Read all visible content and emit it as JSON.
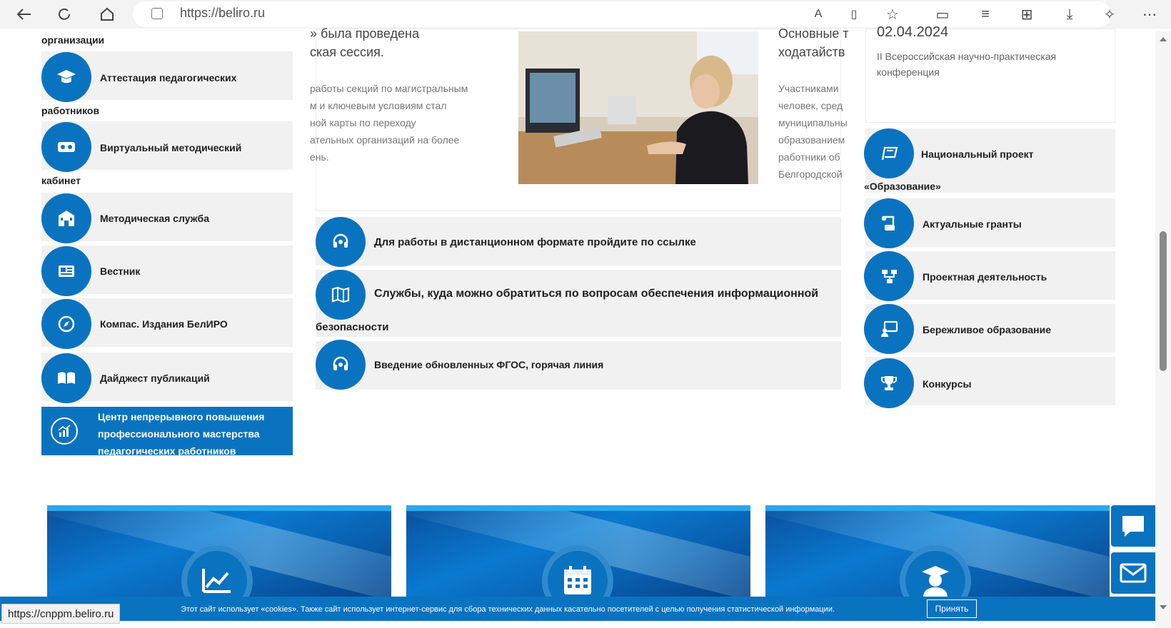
{
  "browser": {
    "url": "https://beliro.ru",
    "status_link": "https://cnppm.beliro.ru"
  },
  "left_menu": {
    "top_cut": "организации",
    "items": [
      {
        "line1": "Аттестация педагогических",
        "line2": "работников",
        "icon": "graduation-cap-icon"
      },
      {
        "line1": "Виртуальный методический",
        "line2": "кабинет",
        "icon": "vr-headset-icon"
      },
      {
        "line1": "Методическая служба",
        "line2": "",
        "icon": "school-building-icon"
      },
      {
        "line1": "Вестник",
        "line2": "",
        "icon": "newspaper-icon"
      },
      {
        "line1": "Компас. Издания БелИРО",
        "line2": "",
        "icon": "compass-icon"
      },
      {
        "line1": "Дайджест публикаций",
        "line2": "",
        "icon": "open-book-icon"
      }
    ],
    "active_item": {
      "label": "Центр непрерывного повышения профессионального мастерства педагогических работников",
      "icon": "chart-growth-icon"
    }
  },
  "news": {
    "title_line1": "» была проведена",
    "title_line2": "ская сессия.",
    "body": [
      "работы секций по магистральным",
      "м и ключевым условиям стал",
      "ной карты по переходу",
      "ательных организаций на более",
      "ень."
    ],
    "right_title_line1": "Основные т",
    "right_title_line2": "ходатайств",
    "right_body": [
      "Участниками",
      "человек, сред",
      "муниципальны",
      "образованием",
      "работники об",
      "Белгородской"
    ]
  },
  "middle_links": [
    {
      "label": "Для работы в дистанционном формате пройдите по ссылке",
      "label2": "",
      "icon": "headset-icon"
    },
    {
      "label": "Службы, куда можно обратиться по вопросам обеспечения информационной",
      "label2": "безопасности",
      "icon": "map-icon"
    },
    {
      "label": "Введение обновленных ФГОС, горячая линия",
      "label2": "",
      "icon": "headset-icon"
    }
  ],
  "event": {
    "date": "02.04.2024",
    "text": "II Всероссийская научно-практическая конференция"
  },
  "right_menu": [
    {
      "line1": "Национальный проект",
      "line2": "«Образование»",
      "icon": "flag-icon"
    },
    {
      "line1": "Актуальные гранты",
      "line2": "",
      "icon": "scroll-icon"
    },
    {
      "line1": "Проектная деятельность",
      "line2": "",
      "icon": "project-tree-icon"
    },
    {
      "line1": "Бережливое образование",
      "line2": "",
      "icon": "presentation-icon"
    },
    {
      "line1": "Конкурсы",
      "line2": "",
      "icon": "trophy-icon"
    }
  ],
  "cookie": {
    "text": "Этот сайт использует «cookies». Также сайт использует интернет-сервис для сбора технических данных касательно посетителей с целью получения статистической информации.",
    "accept": "Принять"
  },
  "colors": {
    "brand": "#0a73c0",
    "panel": "#f1f1f1"
  }
}
